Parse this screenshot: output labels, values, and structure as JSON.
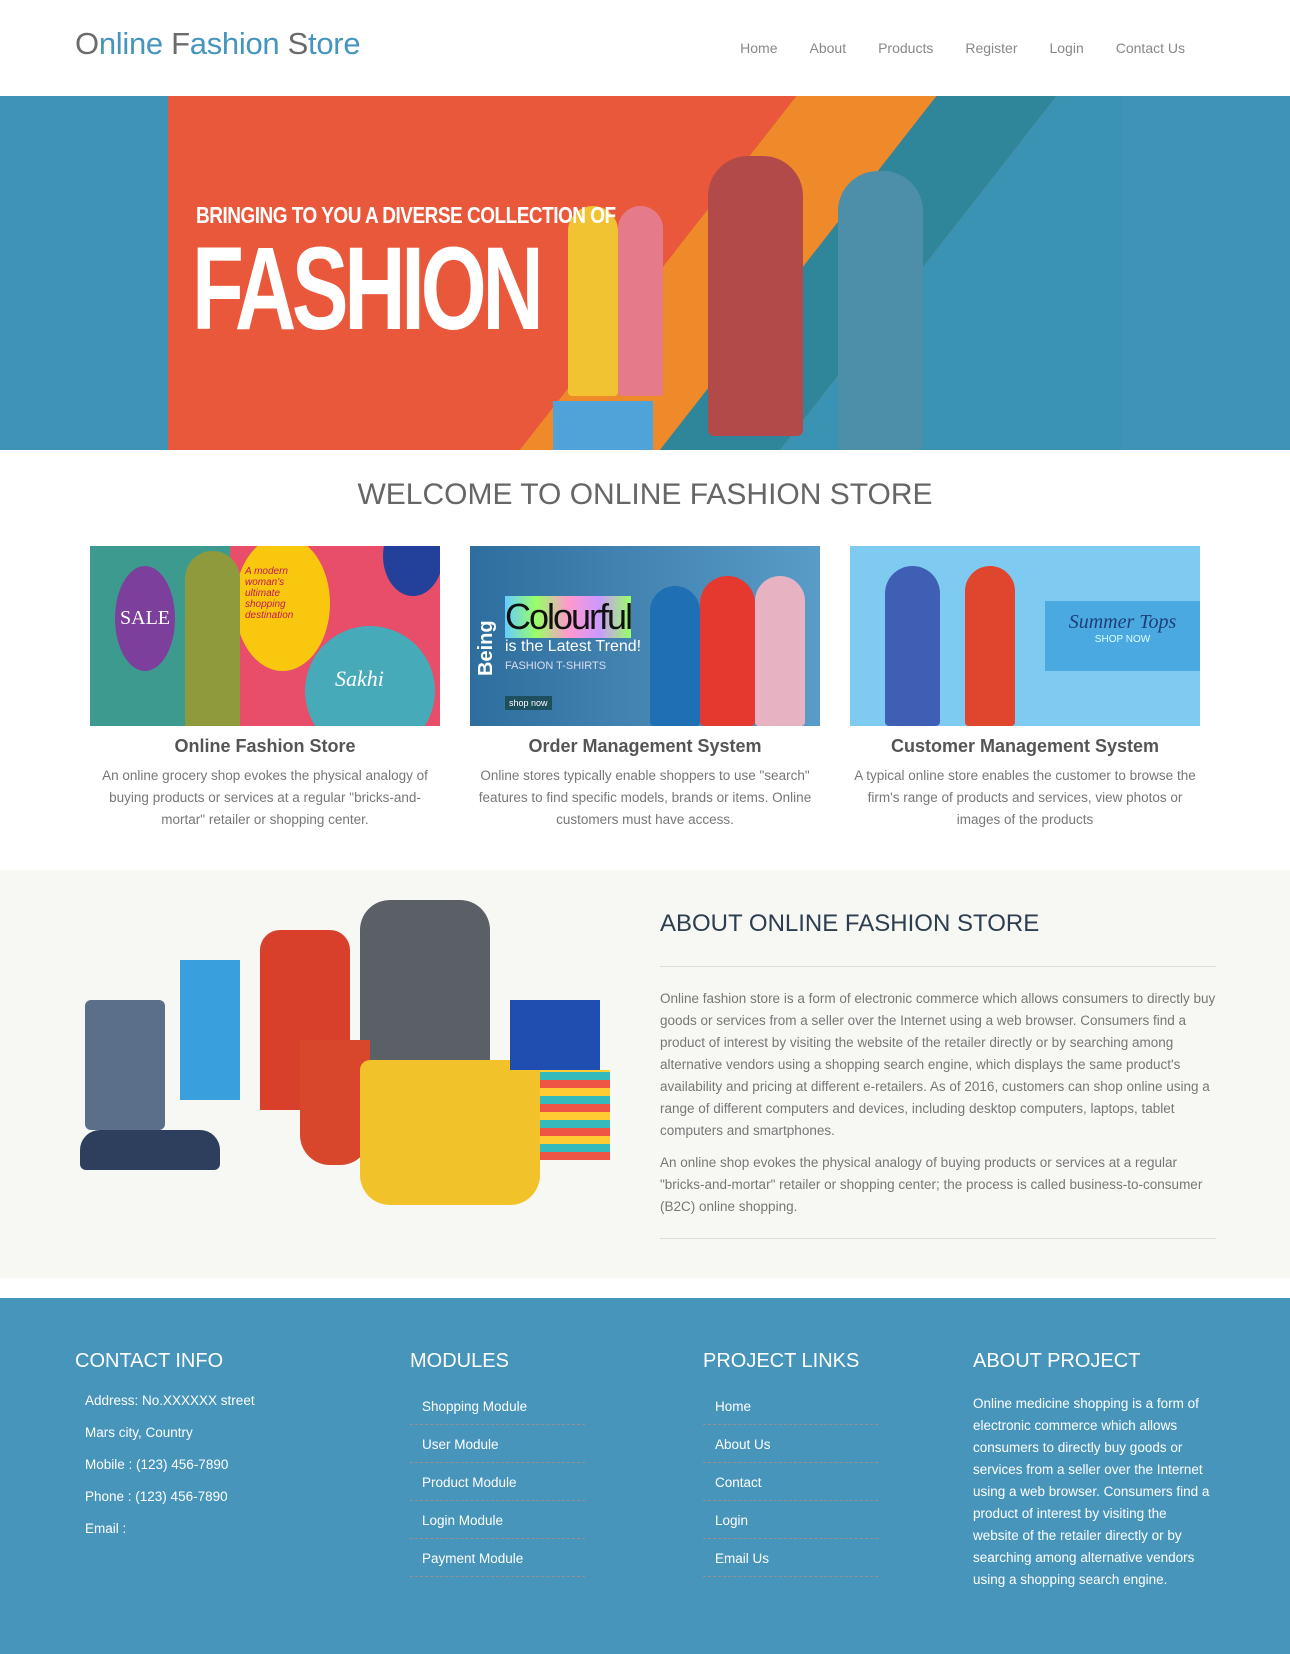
{
  "header": {
    "logo": [
      {
        "t": "O",
        "c": "g"
      },
      {
        "t": "nline ",
        "c": "b"
      },
      {
        "t": "F",
        "c": "g"
      },
      {
        "t": "ashion ",
        "c": "b"
      },
      {
        "t": "S",
        "c": "g"
      },
      {
        "t": "tore",
        "c": "b"
      }
    ],
    "logo_text": "Online Fashion Store",
    "nav": [
      "Home",
      "About",
      "Products",
      "Register",
      "Login",
      "Contact Us"
    ]
  },
  "hero": {
    "subtitle": "BRINGING TO YOU A DIVERSE COLLECTION OF",
    "title": "FASHION"
  },
  "welcome": "WELCOME TO ONLINE FASHION STORE",
  "cards": [
    {
      "title": "Online Fashion Store",
      "desc": "An online grocery shop evokes the physical analogy of buying products or services at a regular \"bricks-and-mortar\" retailer or shopping center.",
      "banner": [
        "SALE",
        "A modern woman's ultimate shopping destination",
        "Sakhi"
      ]
    },
    {
      "title": "Order Management System",
      "desc": "Online stores typically enable shoppers to use \"search\" features to find specific models, brands or items. Online customers must have access.",
      "banner": [
        "Being",
        "Colourful",
        "is the Latest Trend!",
        "FASHION T-SHIRTS",
        "shop now"
      ]
    },
    {
      "title": "Customer Management System",
      "desc": "A typical online store enables the customer to browse the firm's range of products and services, view photos or images of the products",
      "banner": [
        "Summer Tops",
        "SHOP NOW"
      ]
    }
  ],
  "about": {
    "title": "ABOUT ONLINE FASHION STORE",
    "paragraphs": [
      "Online fashion store is a form of electronic commerce which allows consumers to directly buy goods or services from a seller over the Internet using a web browser. Consumers find a product of interest by visiting the website of the retailer directly or by searching among alternative vendors using a shopping search engine, which displays the same product's availability and pricing at different e-retailers. As of 2016, customers can shop online using a range of different computers and devices, including desktop computers, laptops, tablet computers and smartphones.",
      "An online shop evokes the physical analogy of buying products or services at a regular \"bricks-and-mortar\" retailer or shopping center; the process is called business-to-consumer (B2C) online shopping."
    ]
  },
  "footer": {
    "contact": {
      "title": "CONTACT INFO",
      "lines": [
        "Address: No.XXXXXX street",
        "Mars city, Country",
        "Mobile : (123) 456-7890",
        "Phone : (123) 456-7890",
        "Email :"
      ]
    },
    "modules": {
      "title": "MODULES",
      "items": [
        "Shopping Module",
        "User Module",
        "Product Module",
        "Login Module",
        "Payment Module"
      ]
    },
    "links": {
      "title": "PROJECT LINKS",
      "items": [
        "Home",
        "About Us",
        "Contact",
        "Login",
        "Email Us"
      ]
    },
    "about": {
      "title": "ABOUT PROJECT",
      "text": "Online medicine shopping is a form of electronic commerce which allows consumers to directly buy goods or services from a seller over the Internet using a web browser. Consumers find a product of interest by visiting the website of the retailer directly or by searching among alternative vendors using a shopping search engine."
    }
  },
  "colors": {
    "brand": "#4595bd",
    "footer": "#4795bb",
    "hero": "#ea583b"
  }
}
